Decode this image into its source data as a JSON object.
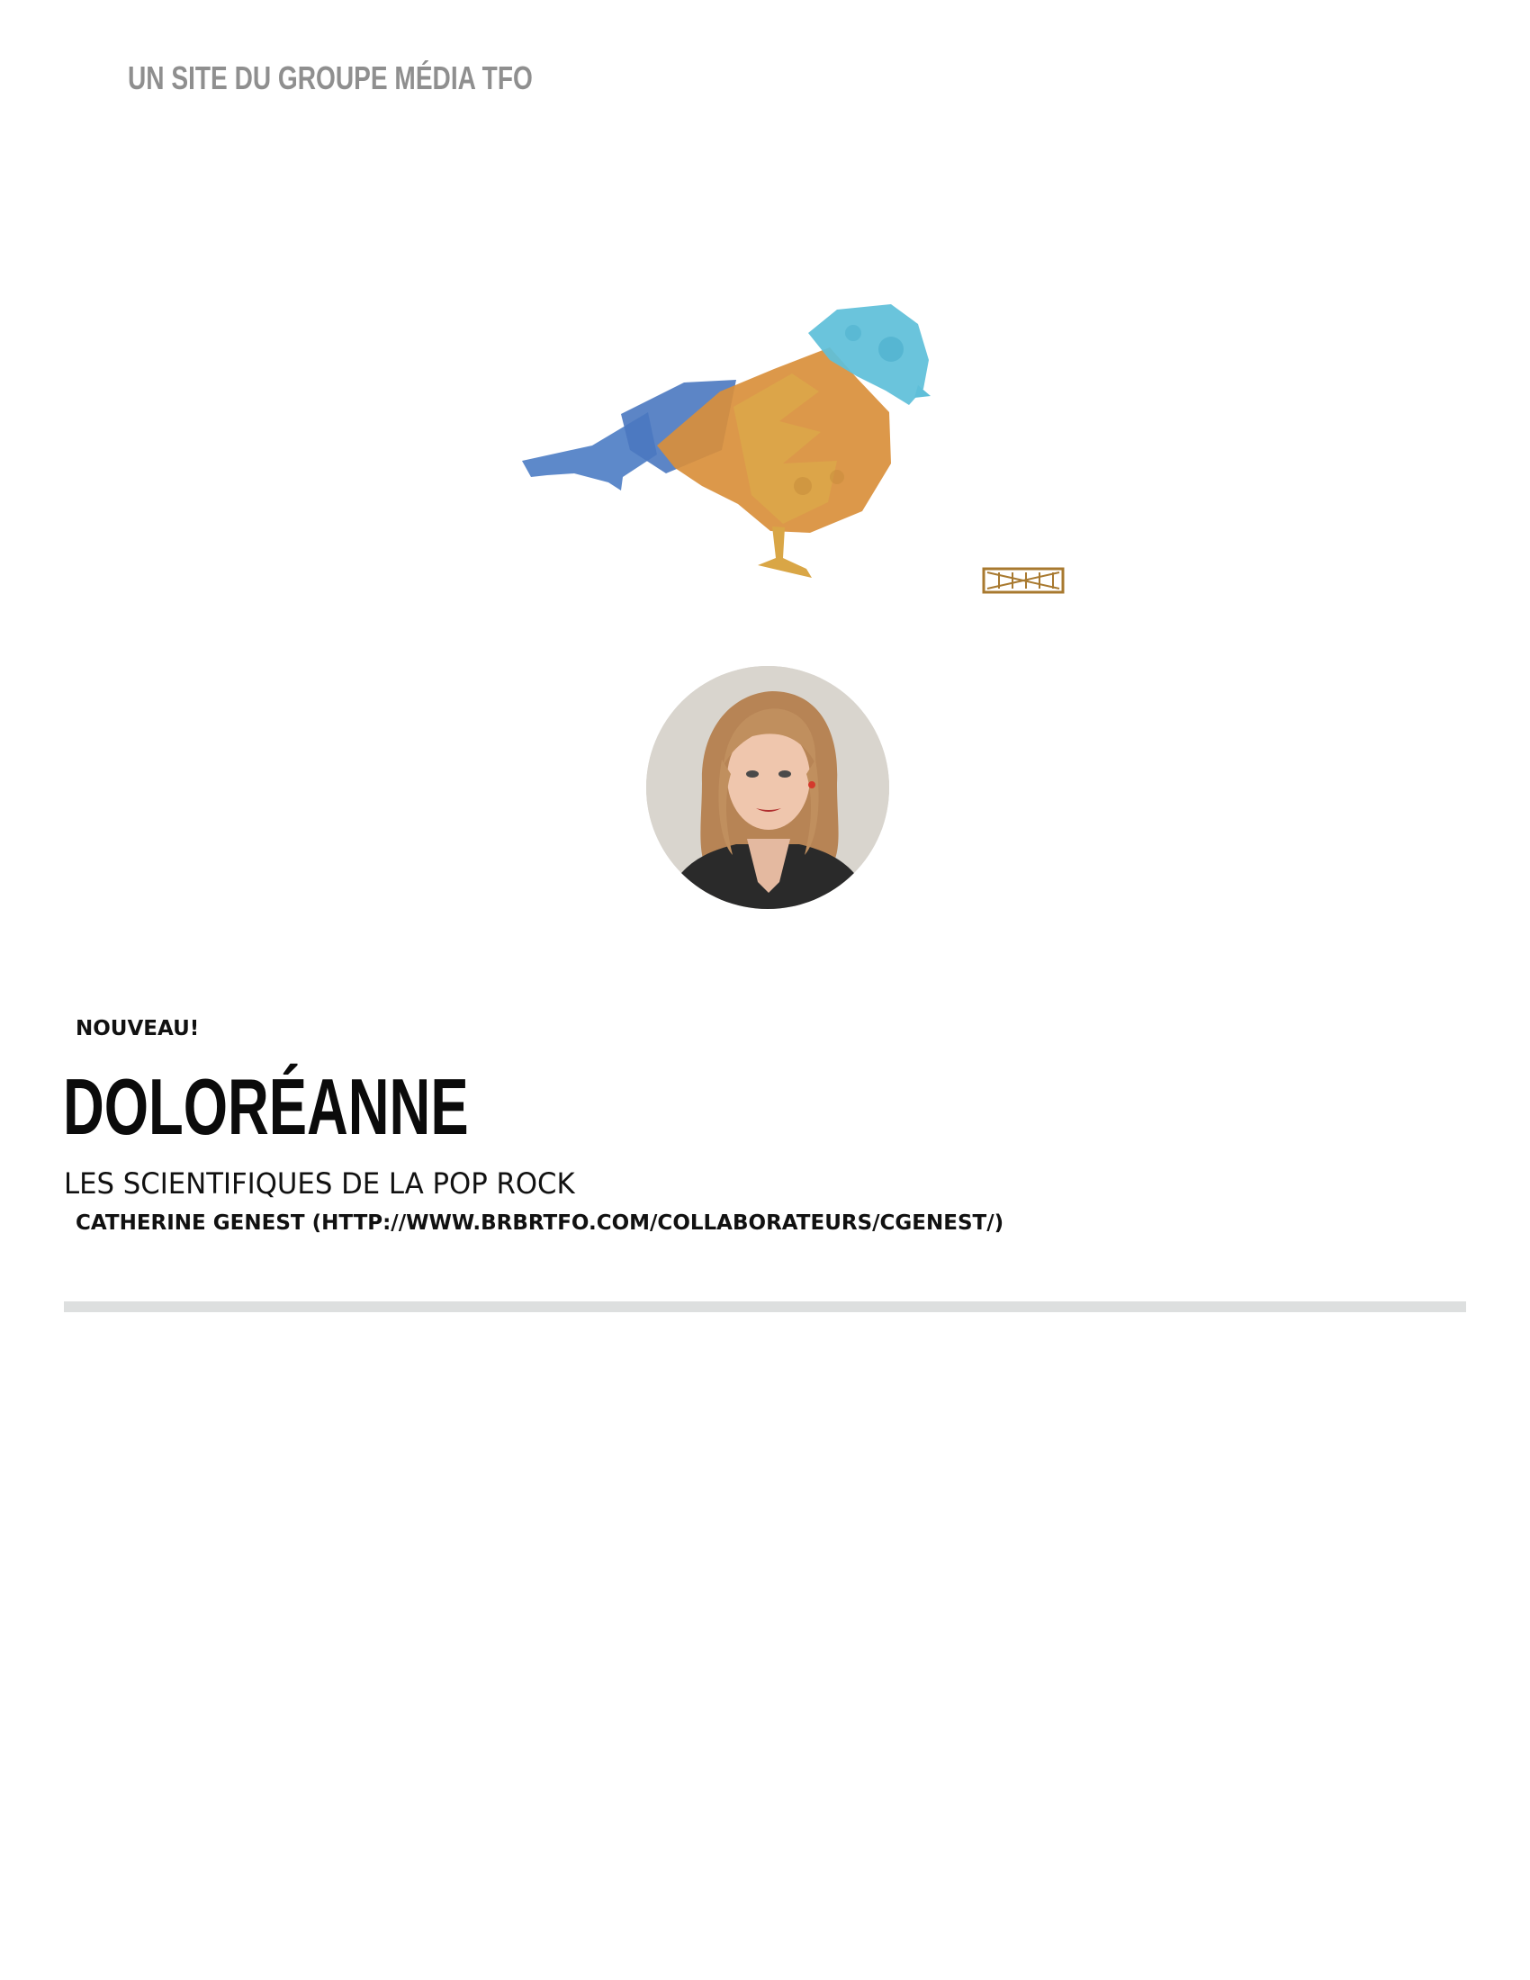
{
  "header": {
    "site_line": "UN SITE DU GROUPE MÉDIA TFO"
  },
  "logo": {
    "icon": "bird-logo-icon",
    "colors": {
      "blue_dark": "#4f7fc6",
      "blue_light": "#5fbfd9",
      "orange": "#d38b3a",
      "gold": "#d9a646",
      "stamp": "#a8792f"
    }
  },
  "profile": {
    "icon": "portrait-avatar-icon"
  },
  "article": {
    "badge": "NOUVEAU!",
    "title": "DOLORÉANNE",
    "subtitle": "LES SCIENTIFIQUES DE LA POP ROCK",
    "author": "CATHERINE GENEST (HTTP://WWW.BRBRTFO.COM/COLLABORATEURS/CGENEST/)"
  },
  "divider": {
    "color": "#dddfdf"
  }
}
